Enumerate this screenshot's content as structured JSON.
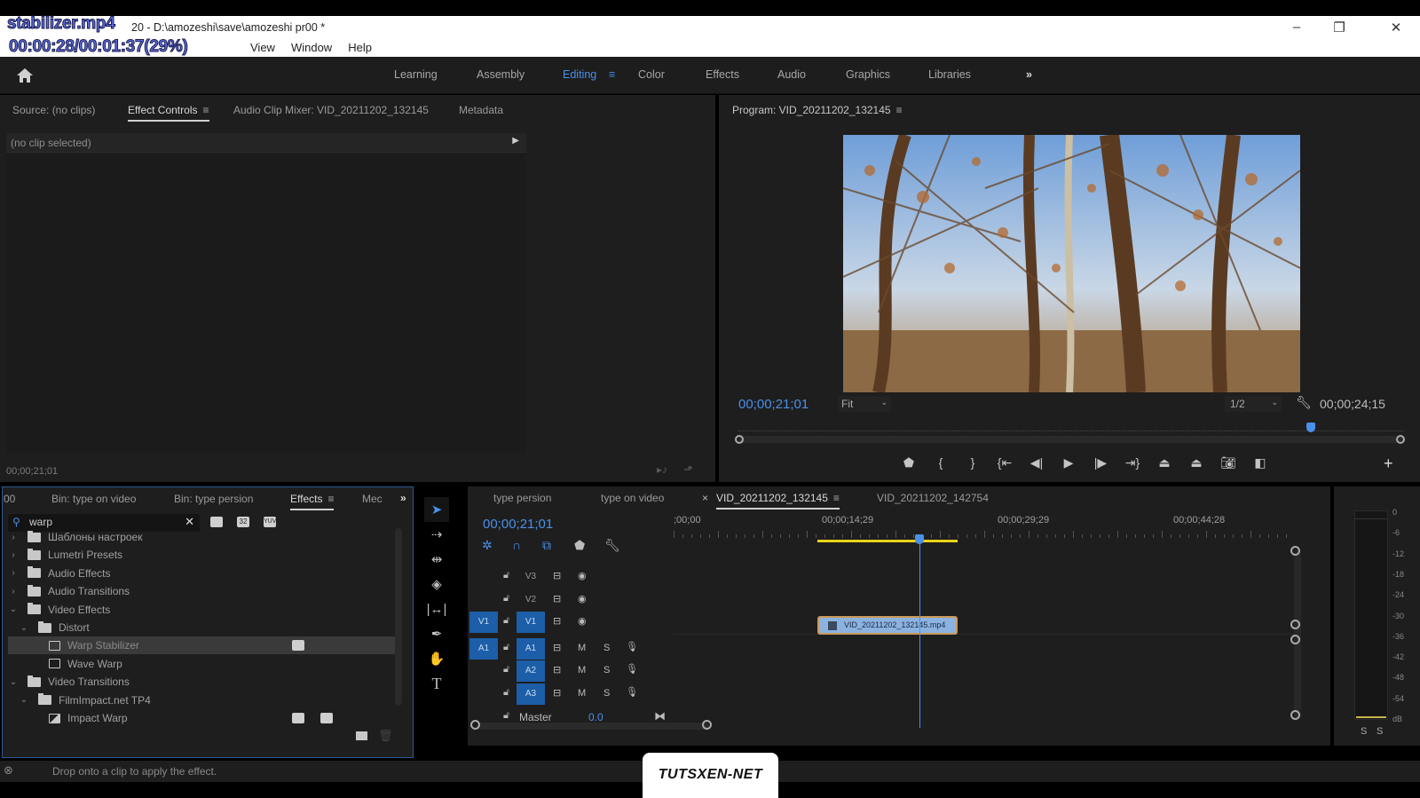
{
  "overlay": {
    "filename": "stabilizer.mp4",
    "playback": "00:00:28/00:01:37(29%)",
    "progress_percent": 29
  },
  "window": {
    "title": "20 - D:\\amozeshi\\save\\amozeshi pr00 *",
    "menu": [
      "View",
      "Window",
      "Help"
    ],
    "controls": {
      "minimize": "–",
      "restore": "❐",
      "close": "✕"
    }
  },
  "workspaces": {
    "tabs": [
      "Learning",
      "Assembly",
      "Editing",
      "Color",
      "Effects",
      "Audio",
      "Graphics",
      "Libraries"
    ],
    "active": "Editing",
    "more": "»"
  },
  "source_panel": {
    "tabs": [
      "Source: (no clips)",
      "Effect Controls",
      "Audio Clip Mixer: VID_20211202_132145",
      "Metadata"
    ],
    "active": "Effect Controls",
    "header": "(no clip selected)",
    "timecode": "00;00;21;01"
  },
  "program_monitor": {
    "title": "Program: VID_20211202_132145",
    "current_timecode": "00;00;21;01",
    "zoom": "Fit",
    "resolution": "1/2",
    "duration": "00;00;24;15",
    "playhead_fraction": 0.86
  },
  "project_panel": {
    "tabs": [
      "00",
      "Bin: type on video",
      "Bin: type persion",
      "Effects",
      "Mec"
    ],
    "active": "Effects",
    "search_value": "warp",
    "filter_badges": [
      "accelerated",
      "32",
      "YUV"
    ],
    "tree": [
      {
        "label": "Шаблоны настроек",
        "level": 0,
        "expanded": false,
        "type": "preset-folder"
      },
      {
        "label": "Lumetri Presets",
        "level": 0,
        "expanded": false,
        "type": "preset-folder"
      },
      {
        "label": "Audio Effects",
        "level": 0,
        "expanded": false,
        "type": "folder"
      },
      {
        "label": "Audio Transitions",
        "level": 0,
        "expanded": false,
        "type": "folder"
      },
      {
        "label": "Video Effects",
        "level": 0,
        "expanded": true,
        "type": "folder"
      },
      {
        "label": "Distort",
        "level": 1,
        "expanded": true,
        "type": "folder"
      },
      {
        "label": "Warp Stabilizer",
        "level": 2,
        "type": "effect",
        "selected": true,
        "badges": [
          "accelerated"
        ]
      },
      {
        "label": "Wave Warp",
        "level": 2,
        "type": "effect"
      },
      {
        "label": "Video Transitions",
        "level": 0,
        "expanded": true,
        "type": "folder"
      },
      {
        "label": "FilmImpact.net TP4",
        "level": 1,
        "expanded": true,
        "type": "folder"
      },
      {
        "label": "Impact Warp",
        "level": 2,
        "type": "transition",
        "badges": [
          "accelerated",
          "32"
        ]
      }
    ]
  },
  "timeline": {
    "tabs": [
      "type persion",
      "type on video",
      "VID_20211202_132145",
      "VID_20211202_142754"
    ],
    "active": "VID_20211202_132145",
    "timecode": "00;00;21;01",
    "ruler": [
      ";00;00",
      "00;00;14;29",
      "00;00;29;29",
      "00;00;44;28"
    ],
    "video_tracks": [
      "V3",
      "V2",
      "V1"
    ],
    "audio_tracks": [
      "A1",
      "A2",
      "A3"
    ],
    "source_patch": {
      "video": "V1",
      "audio": "A1"
    },
    "audio_buttons": {
      "mute": "M",
      "solo": "S"
    },
    "master_label": "Master",
    "master_value": "0.0",
    "clip": "VID_20211202_132145.mp4"
  },
  "audio_meter": {
    "scale": [
      "0",
      "-6",
      "-12",
      "-18",
      "-24",
      "-30",
      "-36",
      "-42",
      "-48",
      "-54",
      "dB"
    ],
    "solo_buttons": [
      "S",
      "S"
    ]
  },
  "status_bar": {
    "message": "Drop onto a clip to apply the effect."
  },
  "watermark": "TUTSXEN-NET",
  "colors": {
    "accent": "#4a90e8",
    "panel": "#1e1e1e",
    "track_chip": "#1c5ea8",
    "work_area": "#e8d21c"
  }
}
